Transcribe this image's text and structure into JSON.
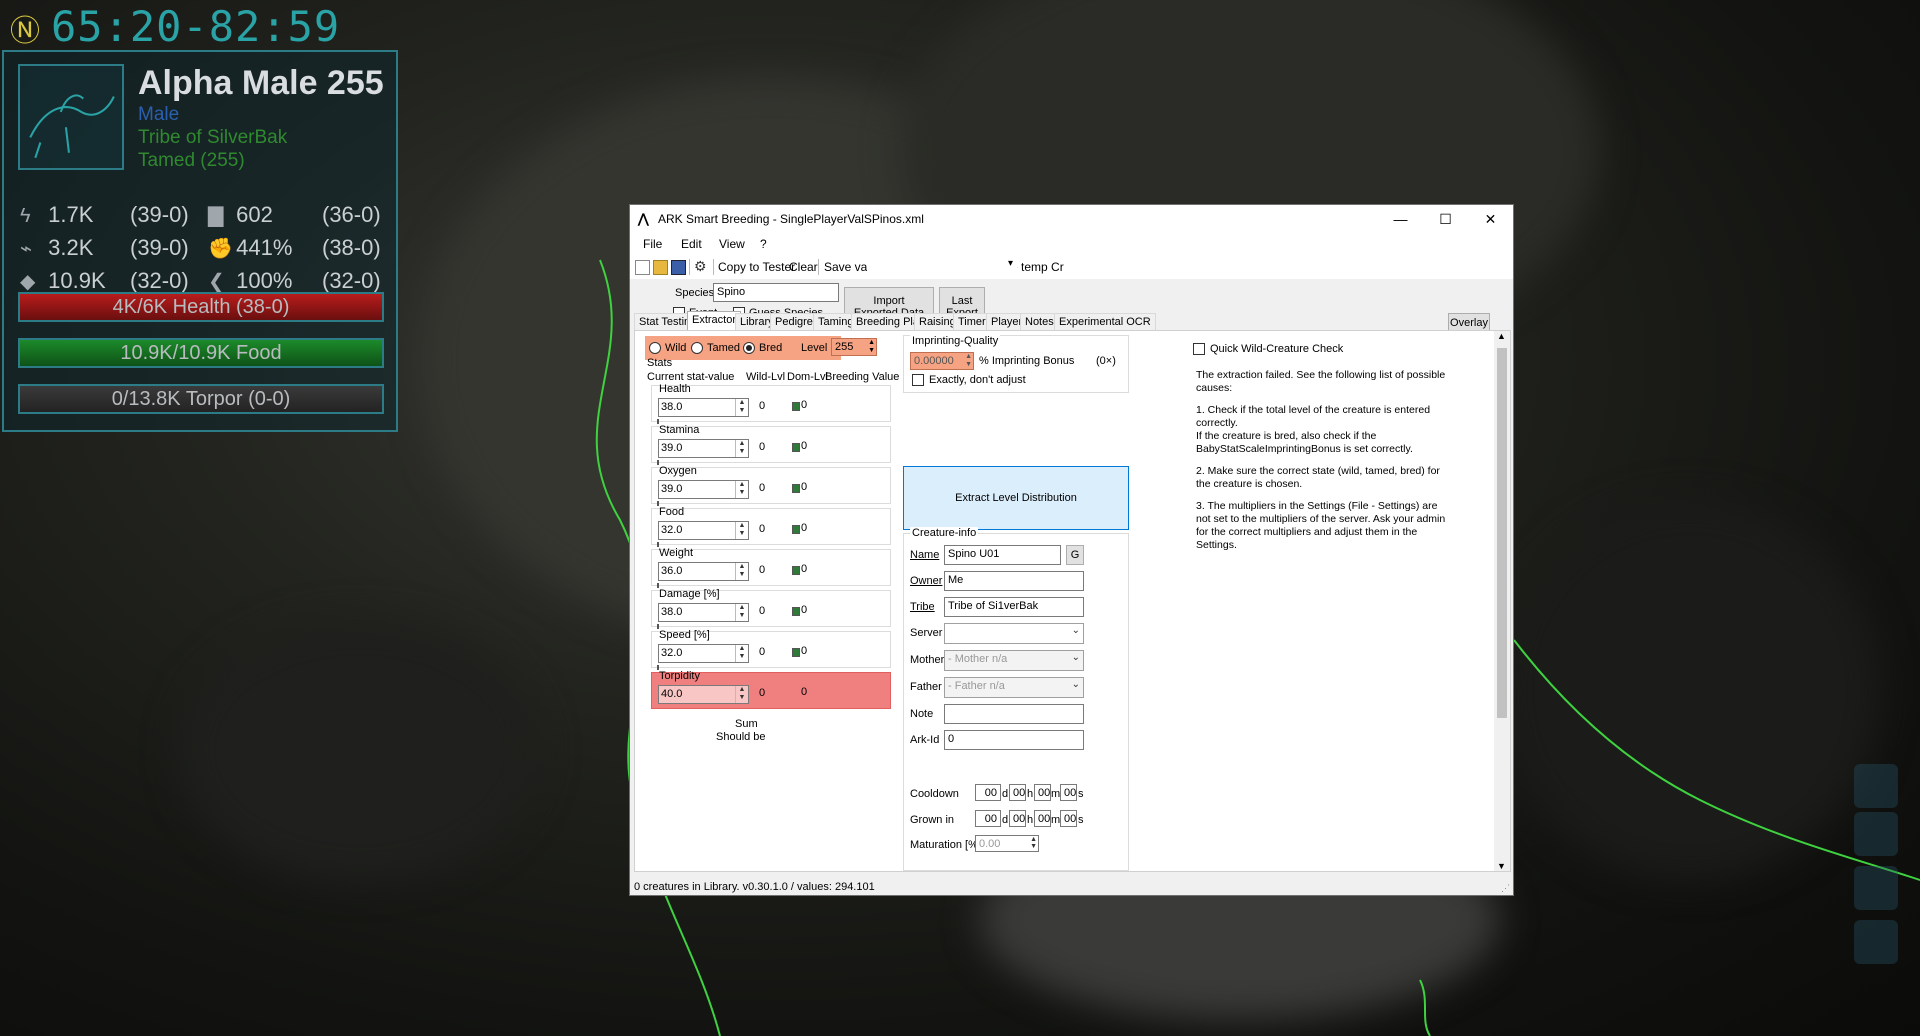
{
  "hud": {
    "clock": "65:20-82:59",
    "name": "Alpha Male 255",
    "gender": "Male",
    "tribe": "Tribe of SilverBak",
    "tamed": "Tamed (255)",
    "stats": [
      {
        "icon": "stamina-icon",
        "glyph": "ϟ",
        "value": "1.7K",
        "levels": "(39-0)"
      },
      {
        "icon": "weight-icon",
        "glyph": "▇",
        "value": "602",
        "levels": "(36-0)"
      },
      {
        "icon": "oxygen-icon",
        "glyph": "⌁",
        "value": "3.2K",
        "levels": "(39-0)"
      },
      {
        "icon": "damage-icon",
        "glyph": "✊",
        "value": "441%",
        "levels": "(38-0)"
      },
      {
        "icon": "food-icon",
        "glyph": "◆",
        "value": "10.9K",
        "levels": "(32-0)"
      },
      {
        "icon": "speed-icon",
        "glyph": "❮",
        "value": "100%",
        "levels": "(32-0)"
      }
    ],
    "health_bar": "4K/6K Health (38-0)",
    "food_bar": "10.9K/10.9K Food",
    "torpor_bar": "0/13.8K Torpor (0-0)"
  },
  "window": {
    "title": "ARK Smart Breeding - SinglePlayerValSPinos.xml",
    "menu": [
      "File",
      "Edit",
      "View",
      "?"
    ],
    "toolbar": {
      "copy": "Copy to Tester",
      "clear": "Clear",
      "save": "Save values",
      "delete": "Delete temp Cr"
    },
    "species_label": "Species",
    "species_value": "Spino",
    "event_label": "Event",
    "guess_label": "Guess Species",
    "import_btn": "Import Exported Data",
    "last_export_btn": "Last Export",
    "overlay_btn": "Overlay",
    "tabs": [
      "Stat Testing",
      "Extractor",
      "Library",
      "Pedigree",
      "Taming",
      "Breeding Plan",
      "Raising",
      "Timer",
      "Player",
      "Notes",
      "Experimental OCR"
    ],
    "active_tab": "Extractor",
    "state": {
      "wild": "Wild",
      "tamed": "Tamed",
      "bred": "Bred",
      "selected": "Bred"
    },
    "level_label": "Level",
    "level_value": "255",
    "stats_header": "Stats",
    "col_current": "Current stat-value",
    "col_wild": "Wild-Lvl",
    "col_dom": "Dom-Lvl",
    "col_breed": "Breeding Value",
    "stats": [
      {
        "name": "Health",
        "value": "38.0",
        "wild": "0",
        "dom": "0"
      },
      {
        "name": "Stamina",
        "value": "39.0",
        "wild": "0",
        "dom": "0"
      },
      {
        "name": "Oxygen",
        "value": "39.0",
        "wild": "0",
        "dom": "0"
      },
      {
        "name": "Food",
        "value": "32.0",
        "wild": "0",
        "dom": "0"
      },
      {
        "name": "Weight",
        "value": "36.0",
        "wild": "0",
        "dom": "0"
      },
      {
        "name": "Damage [%]",
        "value": "38.0",
        "wild": "0",
        "dom": "0"
      },
      {
        "name": "Speed [%]",
        "value": "32.0",
        "wild": "0",
        "dom": "0"
      },
      {
        "name": "Torpidity",
        "value": "40.0",
        "wild": "0",
        "dom": "0"
      }
    ],
    "sum_label": "Sum",
    "should_be_label": "Should be",
    "imprinting": {
      "title": "Imprinting-Quality",
      "value": "0.00000",
      "bonus_label": "% Imprinting Bonus",
      "multiplier": "(0×)",
      "exact_label": "Exactly, don't adjust"
    },
    "extract_btn": "Extract Level Distribution",
    "creature_info": {
      "title": "Creature-info",
      "name_label": "Name",
      "name_value": "Spino U01",
      "g_btn": "G",
      "owner_label": "Owner",
      "owner_value": "Me",
      "tribe_label": "Tribe",
      "tribe_value": "Tribe of Si1verBak",
      "server_label": "Server",
      "server_value": "",
      "mother_label": "Mother",
      "mother_value": "- Mother n/a",
      "father_label": "Father",
      "father_value": "- Father n/a",
      "note_label": "Note",
      "note_value": "",
      "arkid_label": "Ark-Id",
      "arkid_value": "0",
      "cooldown_label": "Cooldown",
      "grown_label": "Grown in",
      "maturation_label": "Maturation [%]",
      "maturation_value": "0.00",
      "time_units": [
        "d",
        "h",
        "m",
        "s"
      ],
      "time_value": "00"
    },
    "quick_check_label": "Quick Wild-Creature Check",
    "failure_text": [
      "The extraction failed. See the following list of possible causes:",
      "1. Check if the total level of the creature is entered correctly.\nIf the creature is bred, also check if the BabyStatScaleImprintingBonus is set correctly.",
      "2. Make sure the correct state (wild, tamed, bred) for the creature is chosen.",
      "3. The multipliers in the Settings (File - Settings) are not set to the multipliers of the server. Ask your admin for the correct multipliers and adjust them in the Settings."
    ],
    "status": "0 creatures in Library. v0.30.1.0 / values: 294.101"
  }
}
